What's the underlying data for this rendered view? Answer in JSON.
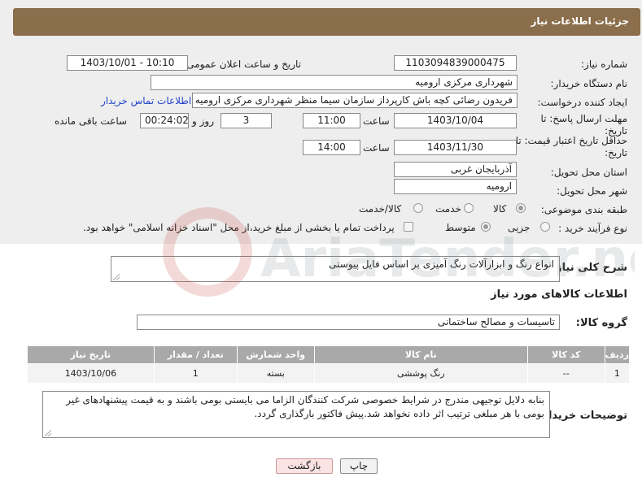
{
  "header": {
    "title": "جزئیات اطلاعات نیاز"
  },
  "form": {
    "need_number_label": "شماره نیاز:",
    "need_number": "1103094839000475",
    "announce_label": "تاریخ و ساعت اعلان عمومی:",
    "announce_value": "1403/10/01 - 10:10",
    "buyer_org_label": "نام دستگاه خریدار:",
    "buyer_org": "شهرداری مرکزی ارومیه",
    "creator_label": "ایجاد کننده درخواست:",
    "creator": "فریدون رضائی کچه باش کارپرداز سازمان سیما منظر شهرداری مرکزی ارومیه",
    "contact_link": "اطلاعات تماس خریدار",
    "deadline_label_1": "مهلت ارسال پاسخ: تا",
    "deadline_label_2": "تاریخ:",
    "deadline_date": "1403/10/04",
    "time_label": "ساعت",
    "deadline_time": "11:00",
    "days_value": "3",
    "days_label": "روز و",
    "remaining_time": "00:24:02",
    "remaining_label": "ساعت باقی مانده",
    "validity_label_1": "حداقل تاریخ اعتبار قیمت: تا",
    "validity_label_2": "تاریخ:",
    "validity_date": "1403/11/30",
    "validity_time": "14:00",
    "province_label": "استان محل تحویل:",
    "province": "آذربایجان غربی",
    "city_label": "شهر محل تحویل:",
    "city": "ارومیه",
    "category_label": "طبقه بندی موضوعی:",
    "category_options": [
      "کالا",
      "خدمت",
      "کالا/خدمت"
    ],
    "process_label": "نوع فرآیند خرید :",
    "process_options": [
      "جزیی",
      "متوسط"
    ],
    "payment_note": "پرداخت تمام یا بخشی از مبلغ خرید،از محل \"اسناد خزانه اسلامی\" خواهد بود."
  },
  "description": {
    "label": "شرح کلی نیاز:",
    "text": "انواع رنگ و ابزارآلات رنگ آمیزی بر اساس فایل پیوستی"
  },
  "goods": {
    "section_title": "اطلاعات کالاهای مورد نیاز",
    "group_label": "گروه کالا:",
    "group_value": "تاسیسات و مصالح ساختمانی",
    "columns": [
      "ردیف",
      "کد کالا",
      "نام کالا",
      "واحد شمارش",
      "تعداد / مقدار",
      "تاریخ نیاز"
    ],
    "rows": [
      [
        "1",
        "--",
        "رنگ پوششی",
        "بسته",
        "1",
        "1403/10/06"
      ]
    ]
  },
  "buyer_notes": {
    "label": "توضیحات خریدار:",
    "text": "بنابه دلایل توجیهی مندرج در شرایط خصوصی شرکت کنندگان الزاما می بایستی بومی باشند و به قیمت پیشنهادهای غیر بومی با هر مبلغی ترتیب اثر داده نخواهد شد.پیش فاکتور بارگذاری گردد."
  },
  "buttons": {
    "print": "چاپ",
    "back": "بازگشت"
  },
  "watermark": {
    "text": "AriaTender.net"
  },
  "colors": {
    "header": "#8b6e4c",
    "table_header": "#a9a9a9",
    "link": "#2244cc"
  }
}
